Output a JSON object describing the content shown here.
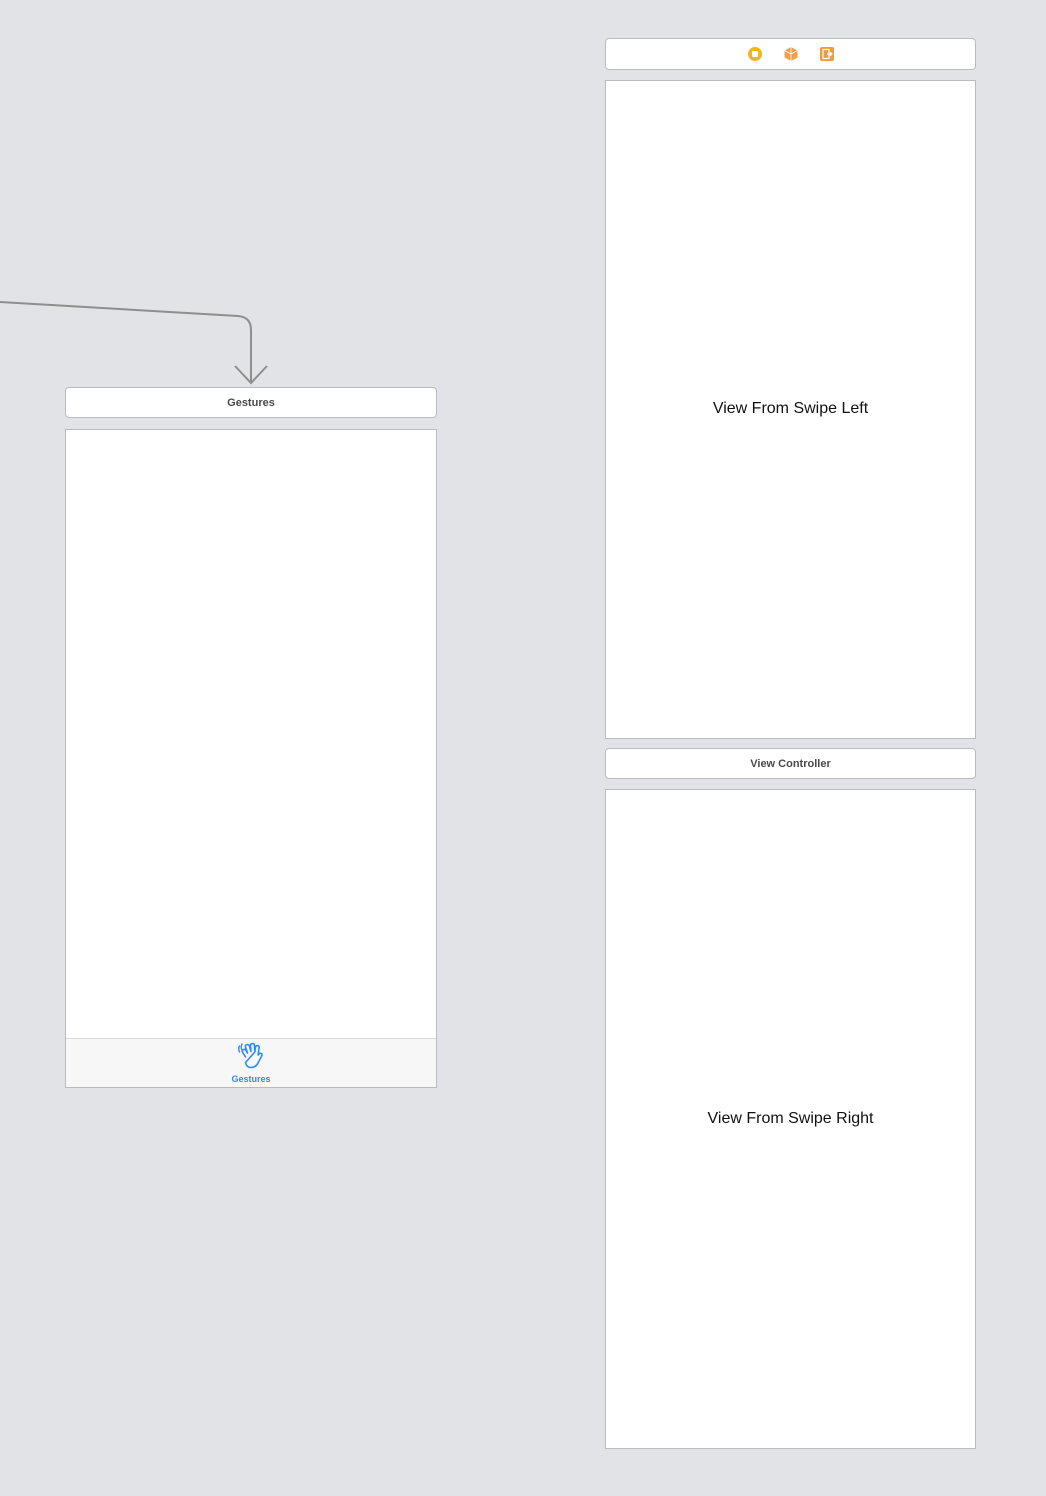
{
  "canvas": {
    "background": "#e2e3e7"
  },
  "segue": {
    "kind": "relationship-arrow",
    "color": "#8e8e8e"
  },
  "gestures_scene": {
    "header_title": "Gestures",
    "tab_bar": {
      "item_label": "Gestures",
      "item_icon": "hand-wave-icon",
      "accent_color": "#2f8cf5"
    }
  },
  "swipe_left_scene": {
    "dock_icons": [
      "view-controller-icon",
      "first-responder-icon",
      "exit-icon"
    ],
    "label": "View From Swipe Left"
  },
  "swipe_right_scene": {
    "header_title": "View Controller",
    "label": "View From Swipe Right"
  }
}
